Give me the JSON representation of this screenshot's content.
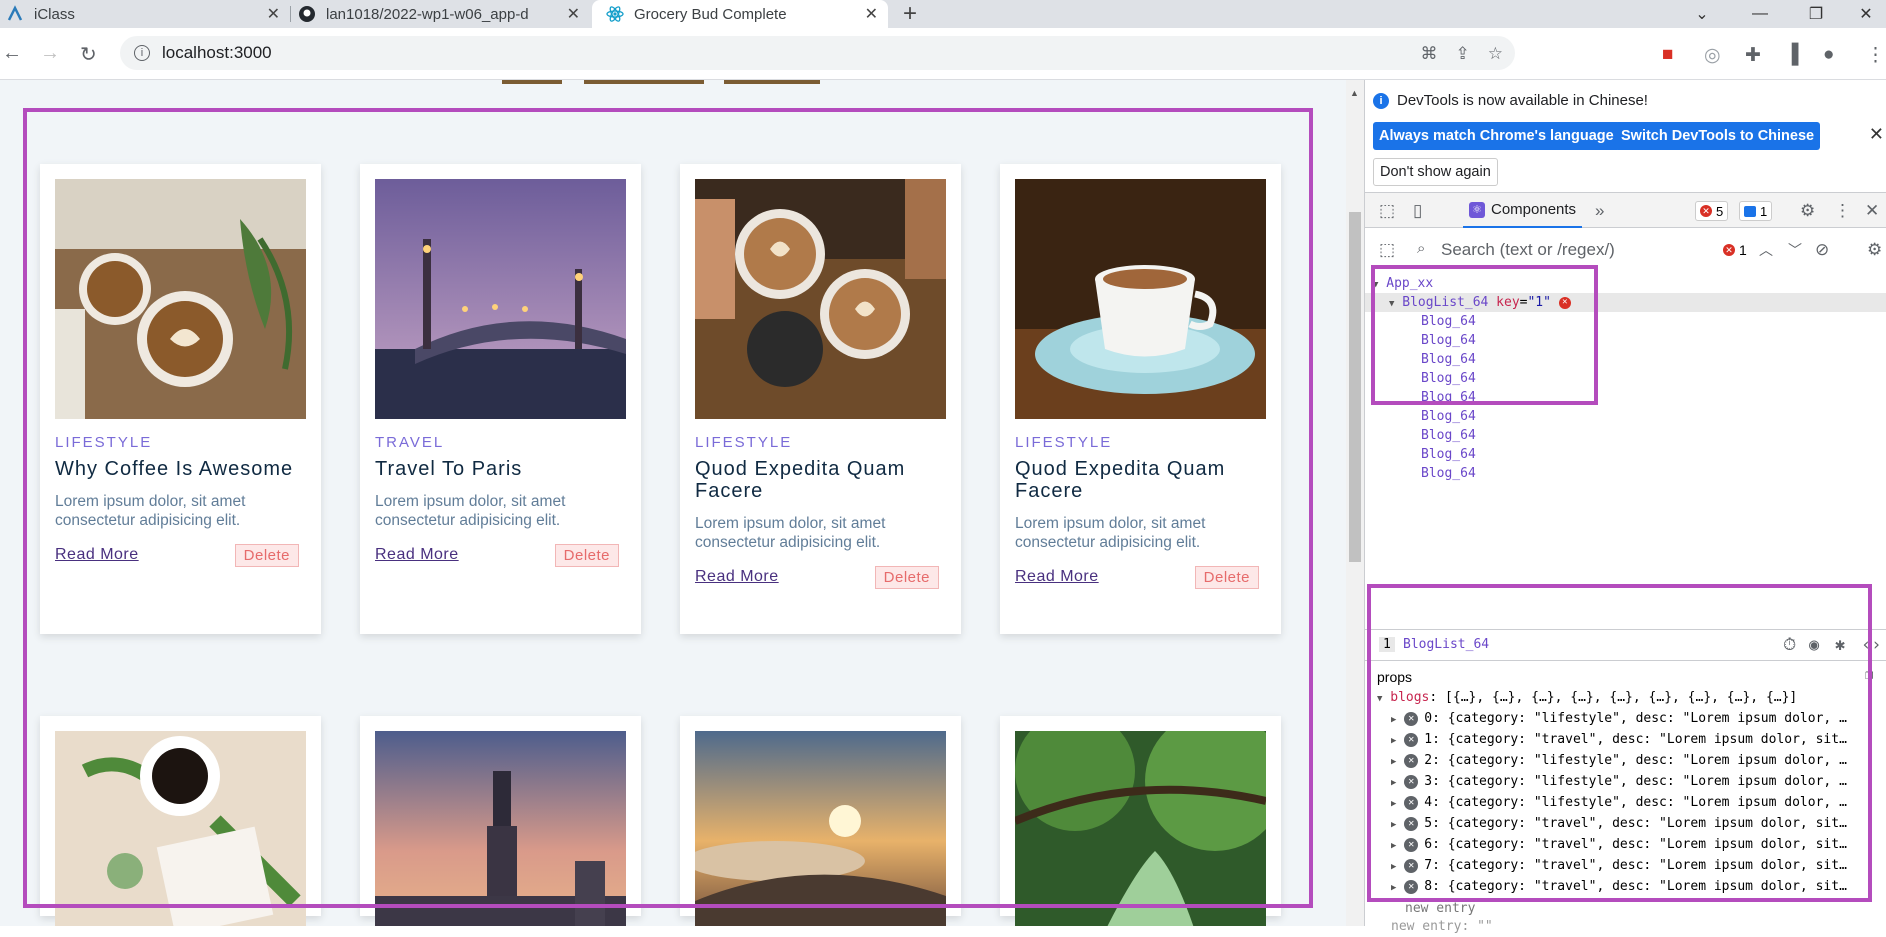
{
  "browser": {
    "tabs": [
      {
        "title": "iClass",
        "active": false
      },
      {
        "title": "lan1018/2022-wp1-w06_app-d",
        "active": false
      },
      {
        "title": "Grocery Bud Complete",
        "active": true
      }
    ],
    "new_tab": "+",
    "url": "localhost:3000",
    "win_min": "⌄",
    "win_minimize": "—",
    "win_restore": "❐",
    "win_close": "✕"
  },
  "colors": {
    "highlight": "#b44cbd",
    "category": "#7a6bd8",
    "delete": "#e66b6b",
    "react": "#6f58d8",
    "devtools_blue": "#1a73e8"
  },
  "cards": [
    {
      "category": "LIFESTYLE",
      "title": "Why Coffee Is Awesome",
      "desc": "Lorem ipsum dolor, sit amet consectetur adipisicing elit.",
      "read_more": "Read More",
      "delete": "Delete",
      "image": "coffee-latte-art"
    },
    {
      "category": "TRAVEL",
      "title": "Travel To Paris",
      "desc": "Lorem ipsum dolor, sit amet consectetur adipisicing elit.",
      "read_more": "Read More",
      "delete": "Delete",
      "image": "paris-bridge-dusk"
    },
    {
      "category": "LIFESTYLE",
      "title": "Quod Expedita Quam Facere",
      "desc": "Lorem ipsum dolor, sit amet consectetur adipisicing elit.",
      "read_more": "Read More",
      "delete": "Delete",
      "image": "coffee-cheers"
    },
    {
      "category": "LIFESTYLE",
      "title": "Quod Expedita Quam Facere",
      "desc": "Lorem ipsum dolor, sit amet consectetur adipisicing elit.",
      "read_more": "Read More",
      "delete": "Delete",
      "image": "coffee-cup-saucer"
    }
  ],
  "cards_row2": [
    {
      "image": "coffee-leaves-enjoy"
    },
    {
      "image": "taipei-101-skyline"
    },
    {
      "image": "sunrise-clouds"
    },
    {
      "image": "green-forest-river"
    }
  ],
  "devtools": {
    "banner": "DevTools is now available in Chinese!",
    "btn_match": "Always match Chrome's language",
    "btn_switch": "Switch DevTools to Chinese",
    "btn_dont_show": "Don't show again",
    "tab_components": "Components",
    "more_tabs": "»",
    "errors_count": "5",
    "messages_count": "1",
    "search_placeholder": "Search (text or /regex/)",
    "search_errors": "1",
    "tree": {
      "root": "App_xx",
      "list": "BlogList_64",
      "key_name": "key",
      "key_value": "\"1\"",
      "children": [
        "Blog_64",
        "Blog_64",
        "Blog_64",
        "Blog_64",
        "Blog_64",
        "Blog_64",
        "Blog_64",
        "Blog_64",
        "Blog_64"
      ]
    },
    "selected_index": "1",
    "selected_name": "BlogList_64",
    "props_title": "props",
    "blogs_key": "blogs",
    "blogs_summary": "[{…}, {…}, {…}, {…}, {…}, {…}, {…}, {…}, {…}]",
    "entries": [
      {
        "idx": "0:",
        "text": "{category: \"lifestyle\", desc: \"Lorem ipsum dolor, …"
      },
      {
        "idx": "1:",
        "text": "{category: \"travel\", desc: \"Lorem ipsum dolor, sit…"
      },
      {
        "idx": "2:",
        "text": "{category: \"lifestyle\", desc: \"Lorem ipsum dolor, …"
      },
      {
        "idx": "3:",
        "text": "{category: \"lifestyle\", desc: \"Lorem ipsum dolor, …"
      },
      {
        "idx": "4:",
        "text": "{category: \"lifestyle\", desc: \"Lorem ipsum dolor, …"
      },
      {
        "idx": "5:",
        "text": "{category: \"travel\", desc: \"Lorem ipsum dolor, sit…"
      },
      {
        "idx": "6:",
        "text": "{category: \"travel\", desc: \"Lorem ipsum dolor, sit…"
      },
      {
        "idx": "7:",
        "text": "{category: \"travel\", desc: \"Lorem ipsum dolor, sit…"
      },
      {
        "idx": "8:",
        "text": "{category: \"travel\", desc: \"Lorem ipsum dolor, sit…"
      }
    ],
    "new_entry": "new entry",
    "new_entry_cut": "new entry: \"\""
  }
}
